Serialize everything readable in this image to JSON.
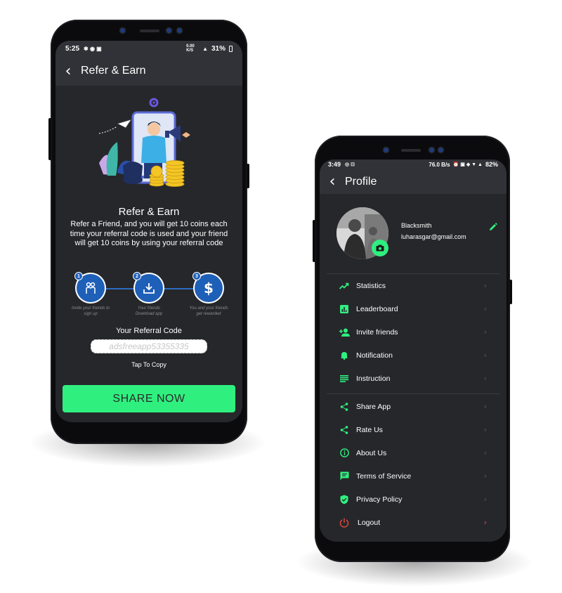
{
  "refer_screen": {
    "status": {
      "time": "5:25",
      "net": "0.00 K/S",
      "battery": "31%"
    },
    "title": "Refer & Earn",
    "heading": "Refer & Earn",
    "description": "Refer a Friend, and you will get 10 coins each time your referral code is used and your friend will get 10 coins by using your referral code",
    "steps": [
      {
        "num": "1",
        "caption": "Invite your friends to sign up"
      },
      {
        "num": "2",
        "caption": "Your friends Download app"
      },
      {
        "num": "3",
        "caption": "You and your friends get rewarded"
      }
    ],
    "code_label": "Your Referral Code",
    "referral_code": "adsfreeapp53355335",
    "tap_to_copy": "Tap To Copy",
    "share_label": "SHARE NOW"
  },
  "profile_screen": {
    "status": {
      "time": "3:49",
      "net": "76.0 B/s",
      "battery": "82%"
    },
    "title": "Profile",
    "name": "Blacksmith",
    "email": "luharasgar@gmail.com",
    "menu_group1": [
      {
        "label": "Statistics",
        "icon": "trending-up-icon"
      },
      {
        "label": "Leaderboard",
        "icon": "bar-chart-icon"
      },
      {
        "label": "Invite friends",
        "icon": "person-add-icon"
      },
      {
        "label": "Notification",
        "icon": "bell-icon"
      },
      {
        "label": "Instruction",
        "icon": "list-icon"
      }
    ],
    "menu_group2": [
      {
        "label": "Share App",
        "icon": "share-icon"
      },
      {
        "label": "Rate Us",
        "icon": "share-icon"
      },
      {
        "label": "About Us",
        "icon": "info-icon"
      },
      {
        "label": "Terms of Service",
        "icon": "message-icon"
      },
      {
        "label": "Privacy Policy",
        "icon": "shield-check-icon"
      }
    ],
    "logout": "Logout"
  },
  "colors": {
    "accent": "#2ff07f",
    "step_blue": "#1e5fb8",
    "screen_bg": "#26272b",
    "appbar_bg": "#313237",
    "logout_red": "#e8493b"
  }
}
